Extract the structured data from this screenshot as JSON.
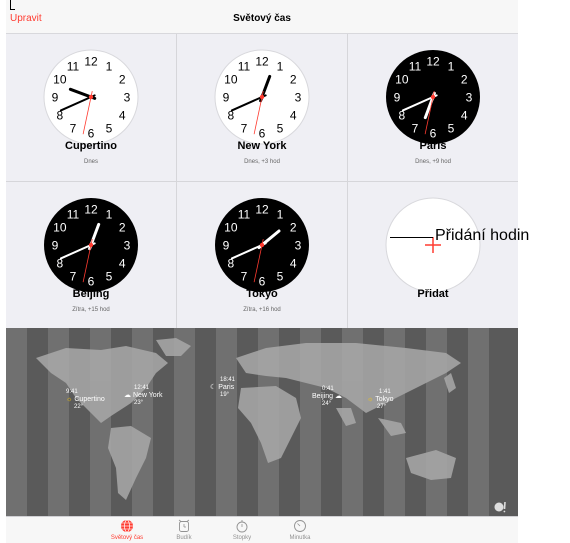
{
  "header": {
    "edit_label": "Upravit",
    "title": "Světový čas"
  },
  "clocks": [
    {
      "city": "Cupertino",
      "sub": "Dnes",
      "face": "light",
      "time": "9:41",
      "numerals": [
        "12",
        "1",
        "2",
        "3",
        "4",
        "5",
        "6",
        "7",
        "8",
        "9",
        "10",
        "11"
      ]
    },
    {
      "city": "New York",
      "sub": "Dnes, +3 hod",
      "face": "light",
      "time": "12:41",
      "numerals": [
        "12",
        "1",
        "2",
        "3",
        "4",
        "5",
        "6",
        "7",
        "8",
        "9",
        "10",
        "11"
      ]
    },
    {
      "city": "Paris",
      "sub": "Dnes, +9 hod",
      "face": "dark",
      "time": "18:41",
      "numerals": [
        "12",
        "1",
        "2",
        "3",
        "4",
        "5",
        "6",
        "7",
        "8",
        "9",
        "10",
        "11"
      ]
    },
    {
      "city": "Beijing",
      "sub": "Zítra, +15 hod",
      "face": "dark",
      "time": "0:41",
      "numerals": [
        "12",
        "1",
        "2",
        "3",
        "4",
        "5",
        "6",
        "7",
        "8",
        "9",
        "10",
        "11"
      ]
    },
    {
      "city": "Tokyo",
      "sub": "Zítra, +16 hod",
      "face": "dark",
      "time": "1:41",
      "numerals": [
        "12",
        "1",
        "2",
        "3",
        "4",
        "5",
        "6",
        "7",
        "8",
        "9",
        "10",
        "11"
      ]
    }
  ],
  "add_clock": {
    "label": "Přidat",
    "icon": "plus-icon"
  },
  "map": {
    "cities": [
      {
        "time": "9:41",
        "name": "Cupertino",
        "temp": "22°",
        "icon": "sun-icon"
      },
      {
        "time": "12:41",
        "name": "New York",
        "temp": "23°",
        "icon": "cloud-icon"
      },
      {
        "time": "18:41",
        "name": "Paris",
        "temp": "19°",
        "icon": "moon-icon"
      },
      {
        "time": "0:41",
        "name": "Beijing",
        "temp": "24°",
        "icon": "cloud-icon"
      },
      {
        "time": "1:41",
        "name": "Tokyo",
        "temp": "27°",
        "icon": "sun-icon"
      }
    ],
    "logo_icon": "yahoo-logo-icon"
  },
  "tabs": [
    {
      "label": "Světový čas",
      "icon": "globe-icon",
      "active": true
    },
    {
      "label": "Budík",
      "icon": "alarm-clock-icon",
      "active": false
    },
    {
      "label": "Stopky",
      "icon": "stopwatch-icon",
      "active": false
    },
    {
      "label": "Minutka",
      "icon": "timer-icon",
      "active": false
    }
  ],
  "callout": {
    "text": "Přidání hodin"
  },
  "colors": {
    "accent": "#ff3b30",
    "background": "#efeff4",
    "map": "#5a5a5a",
    "dark_face": "#000000",
    "light_face": "#ffffff"
  }
}
